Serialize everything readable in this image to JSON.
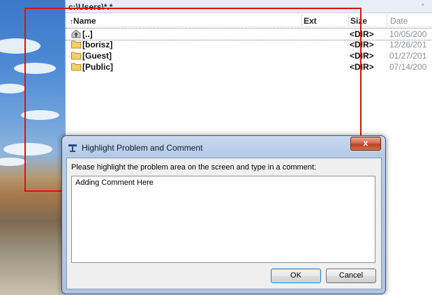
{
  "file_manager": {
    "path": "c:\\Users\\*.*",
    "star": "*",
    "columns": {
      "name": "Name",
      "ext": "Ext",
      "size": "Size",
      "date": "Date"
    },
    "rows": [
      {
        "name": "[..]",
        "size": "<DIR>",
        "date": "10/05/200"
      },
      {
        "name": "[borisz]",
        "size": "<DIR>",
        "date": "12/26/201"
      },
      {
        "name": "[Guest]",
        "size": "<DIR>",
        "date": "01/27/201"
      },
      {
        "name": "[Public]",
        "size": "<DIR>",
        "date": "07/14/200"
      }
    ]
  },
  "dialog": {
    "title": "Highlight Problem and Comment",
    "close_label": "x",
    "prompt": "Please highlight the problem area on the screen and type in a comment:",
    "comment_value": "Adding Comment Here",
    "ok_label": "OK",
    "cancel_label": "Cancel"
  },
  "colors": {
    "highlight_border": "#e01010",
    "ok_focus": "#3c7fb1",
    "close_button": "#c0411f",
    "folder": "#f4cf6a"
  }
}
